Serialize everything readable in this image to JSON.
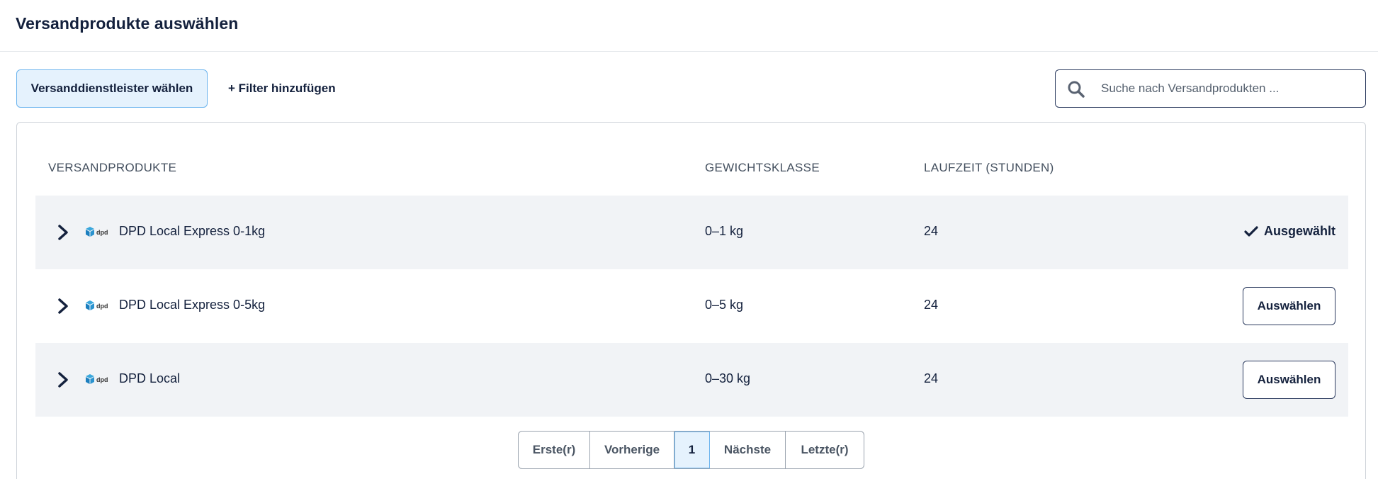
{
  "header": {
    "title": "Versandprodukte auswählen"
  },
  "toolbar": {
    "carrier_button": "Versanddienstleister wählen",
    "filter_button": "+ Filter hinzufügen",
    "search_placeholder": "Suche nach Versandprodukten ..."
  },
  "table": {
    "columns": [
      "VERSANDPRODUKTE",
      "GEWICHTSKLASSE",
      "LAUFZEIT (STUNDEN)"
    ],
    "rows": [
      {
        "product": "DPD Local Express 0-1kg",
        "weight": "0–1 kg",
        "hours": "24",
        "action": "Ausgewählt",
        "selected": true,
        "logo_text": "dpd"
      },
      {
        "product": "DPD Local Express 0-5kg",
        "weight": "0–5 kg",
        "hours": "24",
        "action": "Auswählen",
        "selected": false,
        "logo_text": "dpd"
      },
      {
        "product": "DPD Local",
        "weight": "0–30 kg",
        "hours": "24",
        "action": "Auswählen",
        "selected": false,
        "logo_text": "dpd"
      }
    ]
  },
  "pagination": {
    "first": "Erste(r)",
    "prev": "Vorherige",
    "current": "1",
    "next": "Nächste",
    "last": "Letzte(r)"
  },
  "colors": {
    "accent_bg": "#e5f2fd",
    "accent_border": "#6cb4ee",
    "text": "#14213d",
    "row_shade": "#f1f3f6",
    "dpd_red": "#dc0032"
  }
}
